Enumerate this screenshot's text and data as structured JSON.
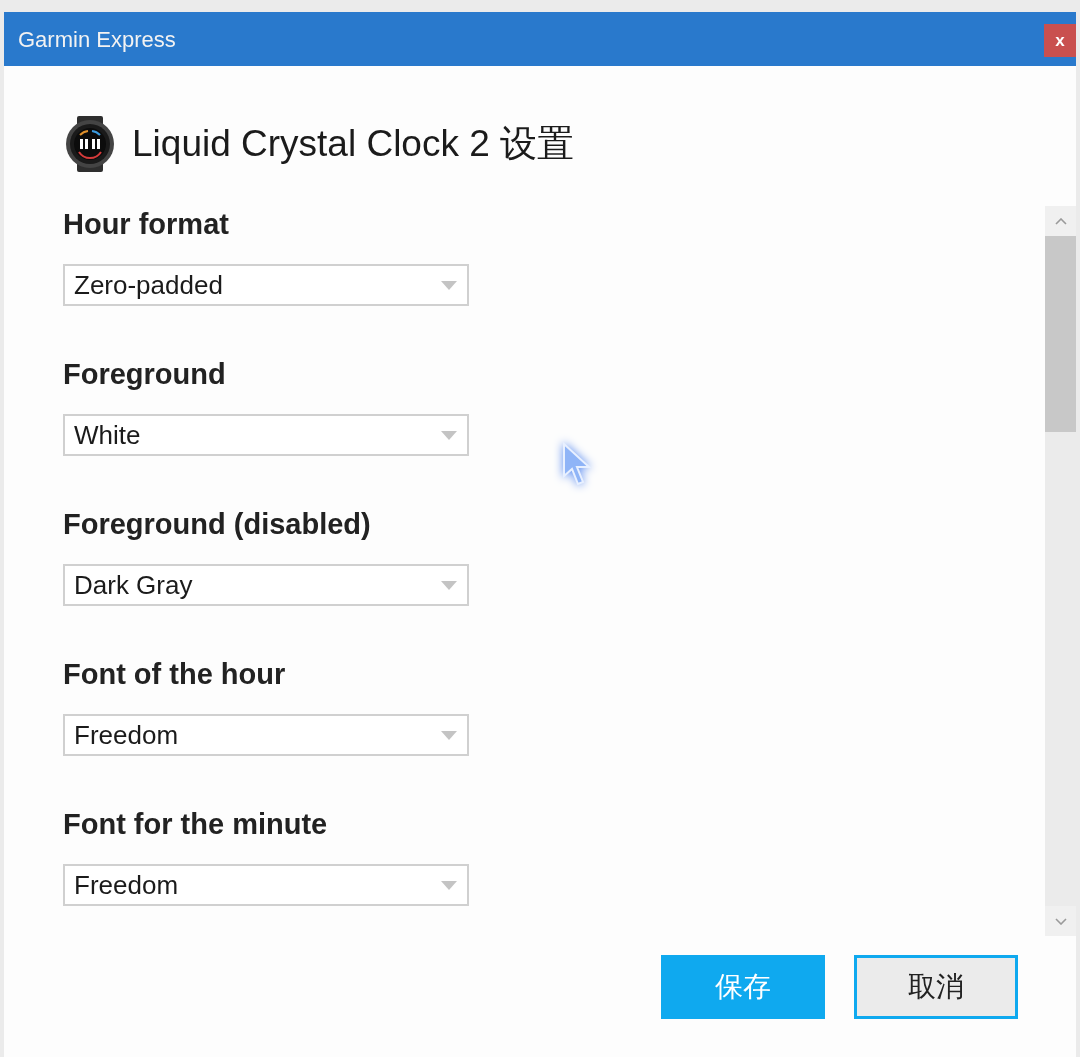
{
  "window": {
    "title": "Garmin Express",
    "close_label": "x"
  },
  "header": {
    "title": "Liquid Crystal Clock 2 设置"
  },
  "settings": [
    {
      "label": "Hour format",
      "value": "Zero-padded"
    },
    {
      "label": "Foreground",
      "value": "White"
    },
    {
      "label": "Foreground (disabled)",
      "value": "Dark Gray"
    },
    {
      "label": "Font of the hour",
      "value": "Freedom"
    },
    {
      "label": "Font for the minute",
      "value": "Freedom"
    }
  ],
  "buttons": [
    {
      "label": "保存",
      "kind": "primary",
      "focused": false
    },
    {
      "label": "取消",
      "kind": "secondary",
      "focused": true
    }
  ]
}
